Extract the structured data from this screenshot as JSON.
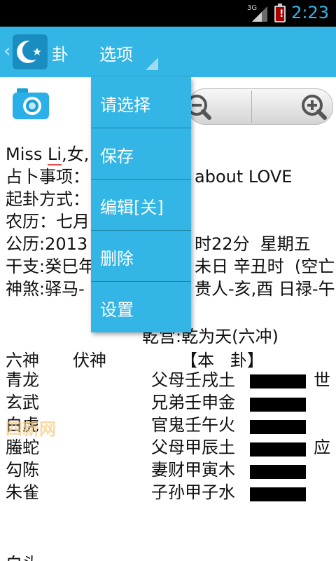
{
  "status_bar": {
    "network": "3G",
    "time": "2:23"
  },
  "action_bar": {
    "app_title": "卦",
    "menu_label": "选项"
  },
  "dropdown": {
    "items": [
      {
        "label": "请选择"
      },
      {
        "label": "保存"
      },
      {
        "label": "编辑[关]"
      },
      {
        "label": "删除"
      },
      {
        "label": "设置"
      }
    ]
  },
  "info": {
    "line1_pre": "Miss ",
    "line1_name": "Li",
    "line1_post": ",女,",
    "line2_pre": "占卜事项：",
    "line2_post": "about LOVE",
    "line3": "起卦方式：",
    "line4": "农历：七月",
    "line5_pre": "公历:2013",
    "line5_post": "时22分  星期五",
    "line6_pre": "干支:癸巳年",
    "line6_post": "未日 辛丑时  (空亡",
    "line7_pre": "神煞:驿马-",
    "line7_post": "贵人-亥,酉 日禄-午"
  },
  "gua": {
    "title": "乾宫:乾为天(六冲)",
    "header": {
      "liushen": "六神",
      "fushen": "伏神",
      "bengua": "【本   卦】"
    },
    "rows": [
      {
        "god": "青龙",
        "yao": "父母壬戌土",
        "mark": "世"
      },
      {
        "god": "玄武",
        "yao": "兄弟壬申金",
        "mark": ""
      },
      {
        "god": "白虎",
        "yao": "官鬼壬午火",
        "mark": ""
      },
      {
        "god": "螣蛇",
        "yao": "父母甲辰土",
        "mark": "应"
      },
      {
        "god": "勾陈",
        "yao": "妻财甲寅木",
        "mark": ""
      },
      {
        "god": "朱雀",
        "yao": "子孙甲子水",
        "mark": ""
      }
    ]
  },
  "watermark": "四新网",
  "bottom_fragment": "白头",
  "colors": {
    "accent": "#33b5e5",
    "status_time": "#33b5e5"
  },
  "icons": {
    "camera": "camera-icon",
    "zoom_out": "zoom-out-icon",
    "zoom_in": "zoom-in-icon",
    "logo": "crescent-star-logo-icon"
  }
}
